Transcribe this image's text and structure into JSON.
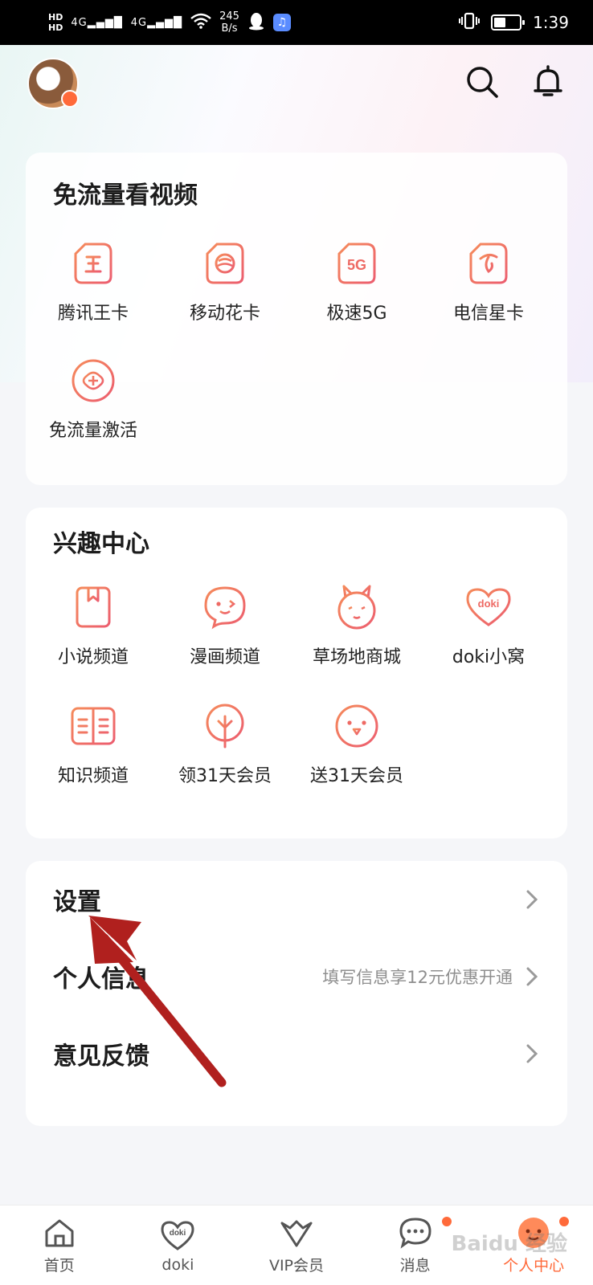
{
  "status_bar": {
    "hd1": "HD",
    "hd2": "HD",
    "signal1": "4G",
    "signal2": "4G",
    "speed_value": "245",
    "speed_unit": "B/s",
    "time": "1:39"
  },
  "free_traffic": {
    "title": "免流量看视频",
    "items": [
      {
        "label": "腾讯王卡",
        "icon": "wang-card-icon",
        "glyph": "王"
      },
      {
        "label": "移动花卡",
        "icon": "mobile-flower-card-icon",
        "glyph": ""
      },
      {
        "label": "极速5G",
        "icon": "5g-icon",
        "glyph": "5G"
      },
      {
        "label": "电信星卡",
        "icon": "telecom-star-card-icon",
        "glyph": ""
      },
      {
        "label": "免流量激活",
        "icon": "unicom-activate-icon",
        "glyph": ""
      }
    ]
  },
  "interest_center": {
    "title": "兴趣中心",
    "items": [
      {
        "label": "小说频道",
        "icon": "novel-book-icon"
      },
      {
        "label": "漫画频道",
        "icon": "comic-face-icon"
      },
      {
        "label": "草场地商城",
        "icon": "rabbit-mall-icon"
      },
      {
        "label": "doki小窝",
        "icon": "doki-heart-icon",
        "glyph": "doki"
      },
      {
        "label": "知识频道",
        "icon": "knowledge-book-icon"
      },
      {
        "label": "领31天会员",
        "icon": "tree-icon"
      },
      {
        "label": "送31天会员",
        "icon": "gift-face-icon"
      }
    ]
  },
  "settings_list": [
    {
      "label": "设置",
      "hint": ""
    },
    {
      "label": "个人信息",
      "hint": "填写信息享12元优惠开通"
    },
    {
      "label": "意见反馈",
      "hint": ""
    }
  ],
  "tabbar": [
    {
      "label": "首页",
      "icon": "home-icon"
    },
    {
      "label": "doki",
      "icon": "doki-heart-icon",
      "glyph": "doki"
    },
    {
      "label": "VIP会员",
      "icon": "vip-crown-icon"
    },
    {
      "label": "消息",
      "icon": "message-icon"
    },
    {
      "label": "个人中心",
      "icon": "profile-face-icon"
    }
  ],
  "watermark": "Baidu 经验",
  "colors": {
    "accent": "#ff6a3a",
    "icon_stroke": "#f0735a",
    "arrow": "#b0201e"
  }
}
